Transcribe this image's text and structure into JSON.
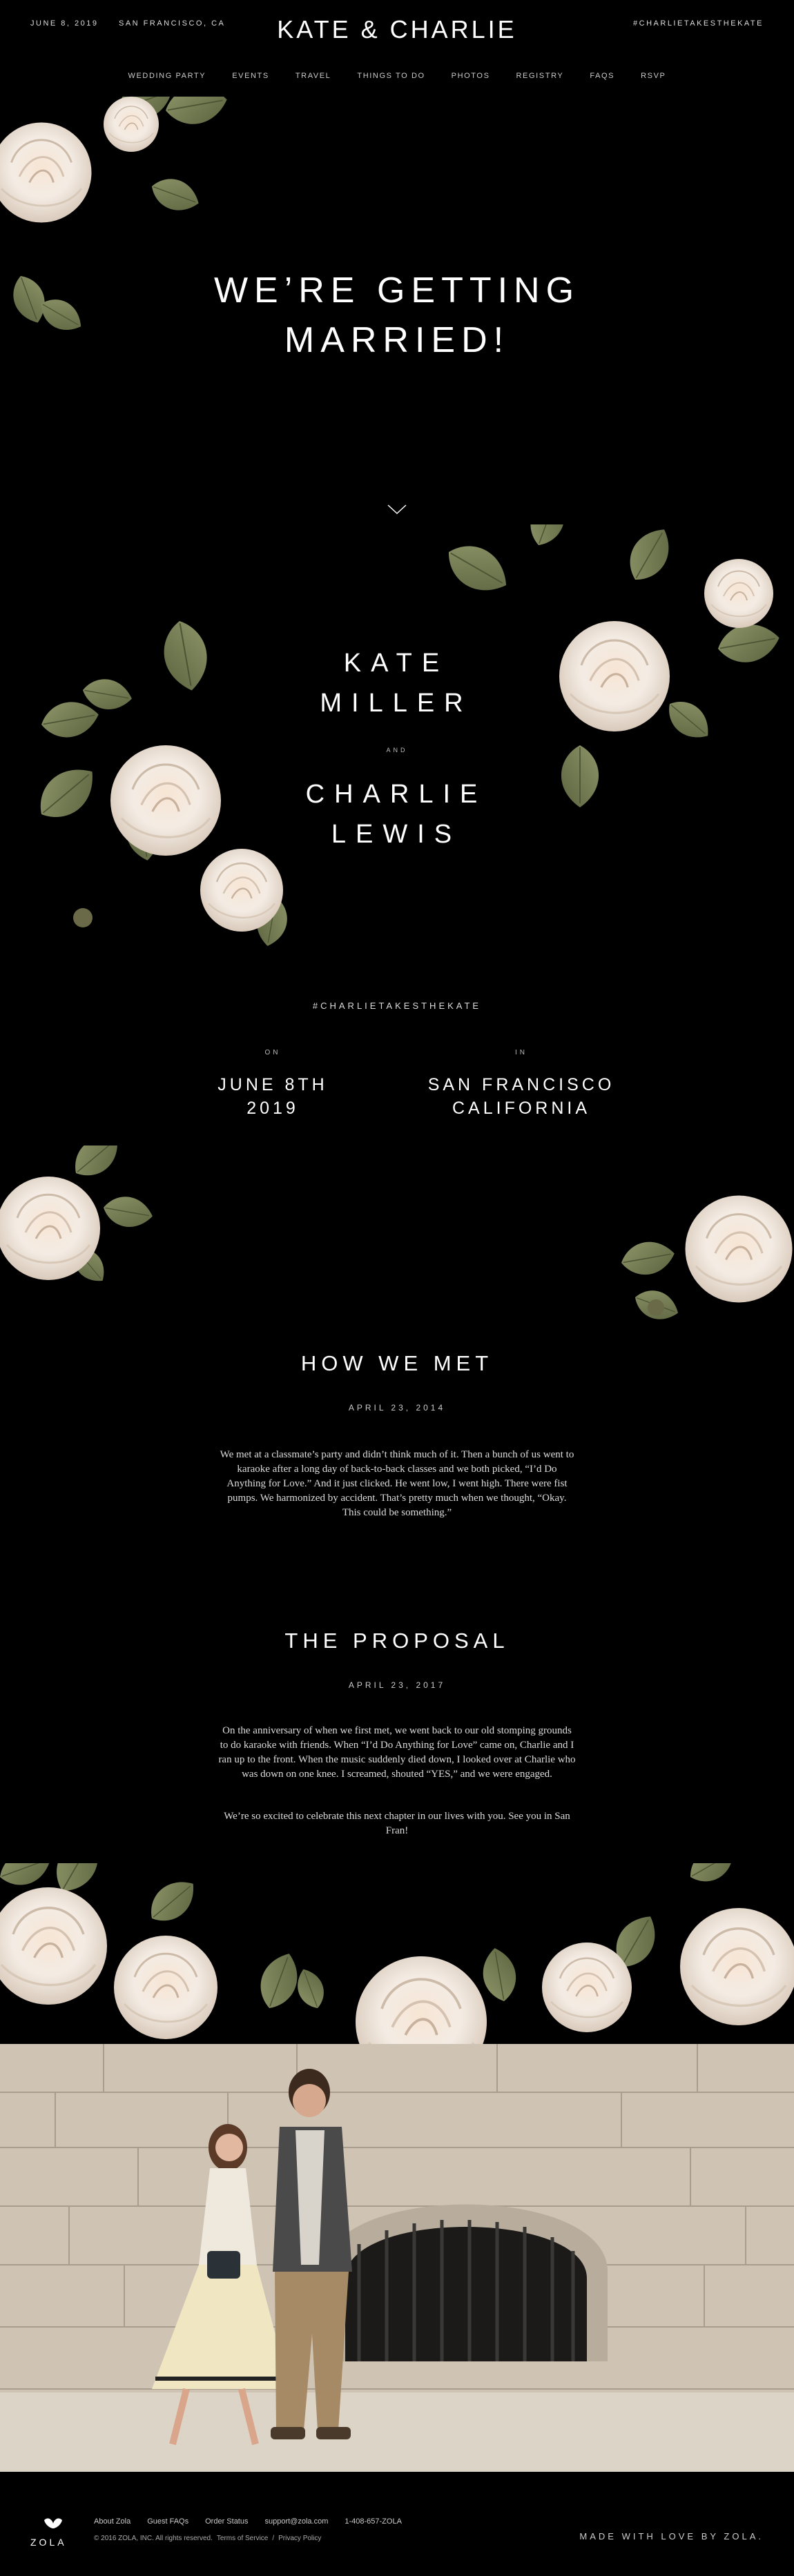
{
  "header": {
    "date": "JUNE 8, 2019",
    "location": "SAN FRANCISCO, CA",
    "title": "KATE & CHARLIE",
    "hashtag": "#CHARLIETAKESTHEKATE"
  },
  "nav": {
    "items": [
      "WEDDING PARTY",
      "EVENTS",
      "TRAVEL",
      "THINGS TO DO",
      "PHOTOS",
      "REGISTRY",
      "FAQS",
      "RSVP"
    ]
  },
  "hero": {
    "line1": "WE’RE GETTING",
    "line2": "MARRIED!"
  },
  "couple": {
    "bride_first": "KATE",
    "bride_last": "MILLER",
    "and": "AND",
    "groom_first": "CHARLIE",
    "groom_last": "LEWIS"
  },
  "details": {
    "hashtag": "#CHARLIETAKESTHEKATE",
    "on_label": "ON",
    "date_line1": "JUNE 8TH",
    "date_line2": "2019",
    "in_label": "IN",
    "place_line1": "SAN FRANCISCO",
    "place_line2": "CALIFORNIA"
  },
  "how_we_met": {
    "title": "HOW WE MET",
    "date": "APRIL 23, 2014",
    "body": "We met at a classmate’s party and didn’t think much of it. Then a bunch of us went to karaoke after a long day of back-to-back classes and we both picked, “I’d Do Anything for Love.” And it just clicked. He went low, I went high. There were fist pumps. We harmonized by accident. That’s pretty much when we thought, “Okay. This could be something.”"
  },
  "proposal": {
    "title": "THE PROPOSAL",
    "date": "APRIL 23, 2017",
    "body1": "On the anniversary of when we first met, we went back to our old stomping grounds to do karaoke with friends. When “I’d Do Anything for Love” came on, Charlie and I ran up to the front. When the music suddenly died down, I looked over at Charlie who was down on one knee. I screamed, shouted “YES,” and we were engaged.",
    "body2": "We’re so excited to celebrate this next chapter in our lives with you. See you in San Fran!"
  },
  "footer": {
    "logo": "ZOLA",
    "links": [
      "About Zola",
      "Guest FAQs",
      "Order Status",
      "support@zola.com",
      "1-408-657-ZOLA"
    ],
    "copyright": "© 2016 ZOLA, INC. All rights reserved.",
    "terms": "Terms of Service",
    "privacy": "Privacy Policy",
    "made_with": "MADE WITH LOVE BY ZOLA."
  },
  "colors": {
    "background": "#000000",
    "text": "#ffffff",
    "rose": "#f3e7dc",
    "leaf": "#7b8556"
  }
}
